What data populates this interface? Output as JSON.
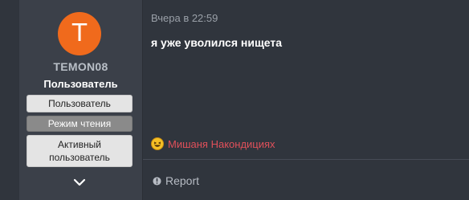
{
  "user": {
    "avatar_letter": "T",
    "username": "TEMON08",
    "title": "Пользователь",
    "banners": [
      "Пользователь",
      "Режим чтения",
      "Активный пользователь"
    ]
  },
  "post": {
    "date": "Вчера в 22:59",
    "text": "я уже уволился нищета",
    "reaction_user": "Мишаня Накондициях",
    "report_label": "Report"
  },
  "icons": {
    "expand": "chevron-down-icon",
    "reaction": "laugh-emoji-icon",
    "report": "info-icon"
  },
  "colors": {
    "avatar": "#f06a1c",
    "reaction_name": "#e0505a",
    "background": "#30353d",
    "sidebar": "#3b4049"
  }
}
